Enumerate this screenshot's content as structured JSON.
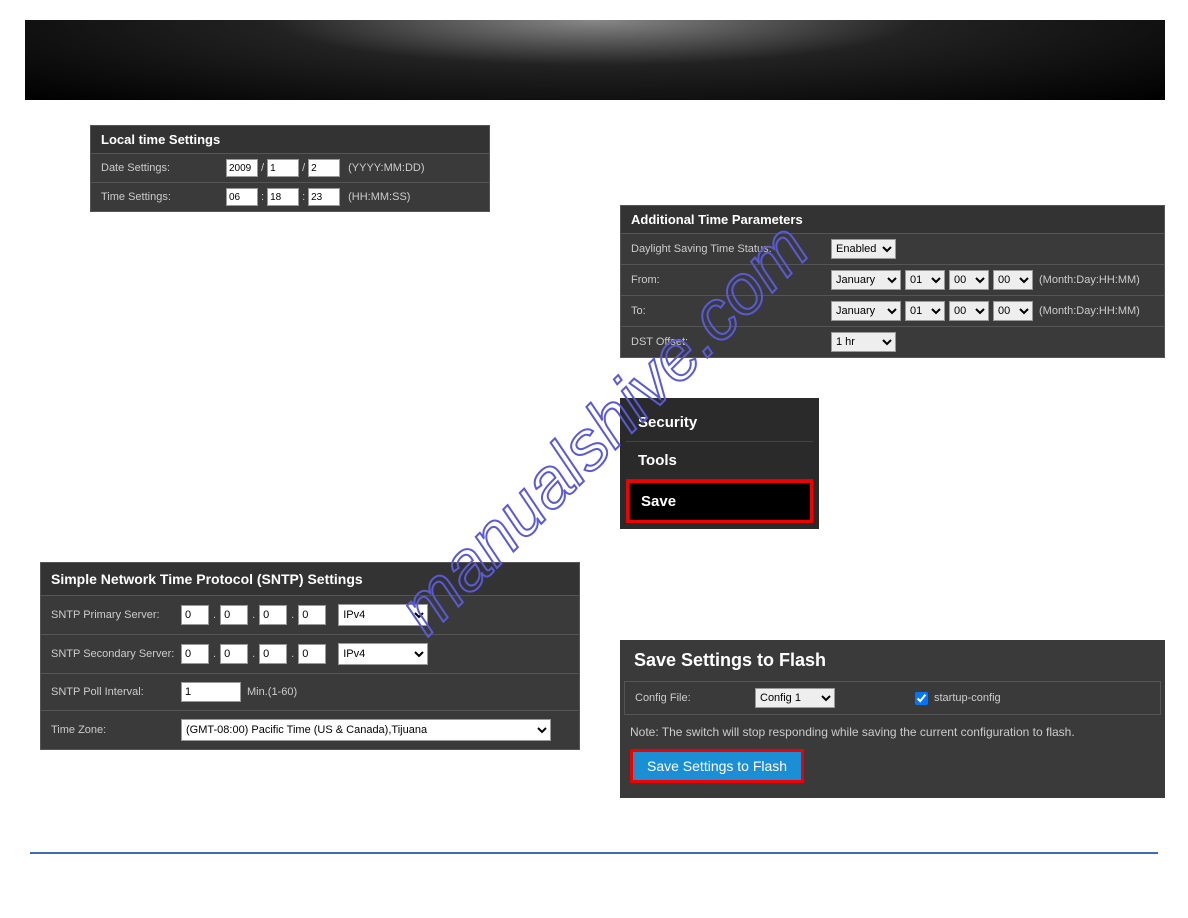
{
  "localTime": {
    "title": "Local time Settings",
    "dateLabel": "Date Settings:",
    "dateHint": "(YYYY:MM:DD)",
    "year": "2009",
    "month": "1",
    "day": "2",
    "timeLabel": "Time Settings:",
    "timeHint": "(HH:MM:SS)",
    "hh": "06",
    "mm": "18",
    "ss": "23"
  },
  "additional": {
    "title": "Additional Time Parameters",
    "dstLabel": "Daylight Saving Time Status:",
    "dstValue": "Enabled",
    "fromLabel": "From:",
    "toLabel": "To:",
    "month": "January",
    "day": "01",
    "hh": "00",
    "mm": "00",
    "hint": "(Month:Day:HH:MM)",
    "offsetLabel": "DST Offset:",
    "offsetValue": "1 hr"
  },
  "menu": {
    "security": "Security",
    "tools": "Tools",
    "save": "Save"
  },
  "sntp": {
    "title": "Simple Network Time Protocol (SNTP) Settings",
    "primaryLabel": "SNTP Primary Server:",
    "secondaryLabel": "SNTP Secondary Server:",
    "pollLabel": "SNTP Poll Interval:",
    "tzLabel": "Time Zone:",
    "octet": "0",
    "ipv": "IPv4",
    "pollValue": "1",
    "pollHint": "Min.(1-60)",
    "tzValue": "(GMT-08:00) Pacific Time (US & Canada),Tijuana"
  },
  "save": {
    "title": "Save Settings to Flash",
    "configLabel": "Config File:",
    "configValue": "Config 1",
    "startupLabel": "startup-config",
    "startupChecked": true,
    "note": "Note: The switch will stop responding while saving the current configuration to flash.",
    "button": "Save Settings to Flash"
  }
}
